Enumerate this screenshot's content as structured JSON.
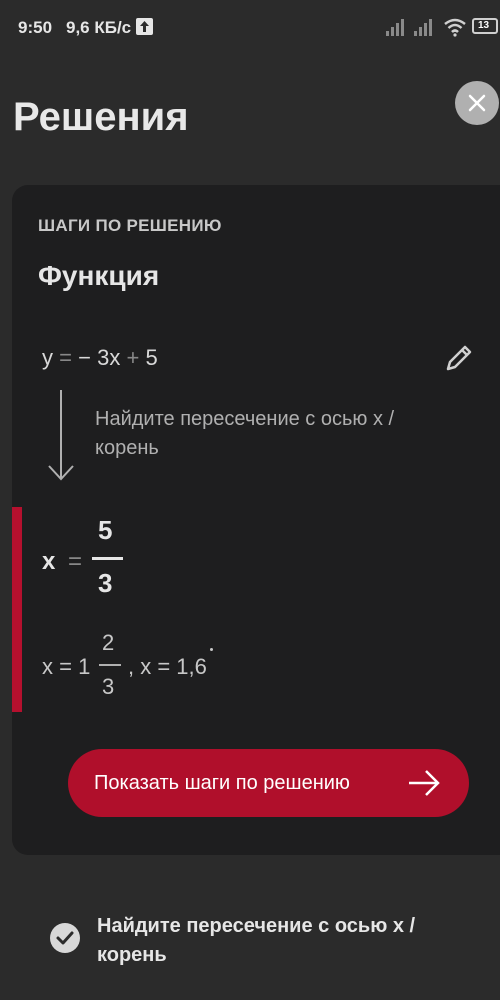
{
  "status_bar": {
    "time": "9:50",
    "speed": "9,6 КБ/с",
    "battery": "13"
  },
  "header": {
    "title": "Решения",
    "close_icon": "close-icon"
  },
  "card": {
    "section_header": "ШАГИ ПО РЕШЕНИЮ",
    "function_title": "Функция",
    "equation": {
      "y": "y",
      "eq": "=",
      "minus": "−",
      "term1": "3x",
      "plus": "+",
      "term2": "5"
    },
    "step_hint": "Найдите пересечение с осью x / корень",
    "result": {
      "x": "x",
      "eq": "=",
      "numerator": "5",
      "denominator": "3"
    },
    "alt_result": {
      "x1": "x = 1",
      "numerator": "2",
      "denominator": "3",
      "x2": ", x = 1,6"
    },
    "show_steps_label": "Показать шаги по решению"
  },
  "bottom": {
    "text": "Найдите пересечение с осью x / корень"
  },
  "colors": {
    "accent": "#b00f2b",
    "background": "#2b2b2b",
    "card": "#1e1e1f"
  }
}
